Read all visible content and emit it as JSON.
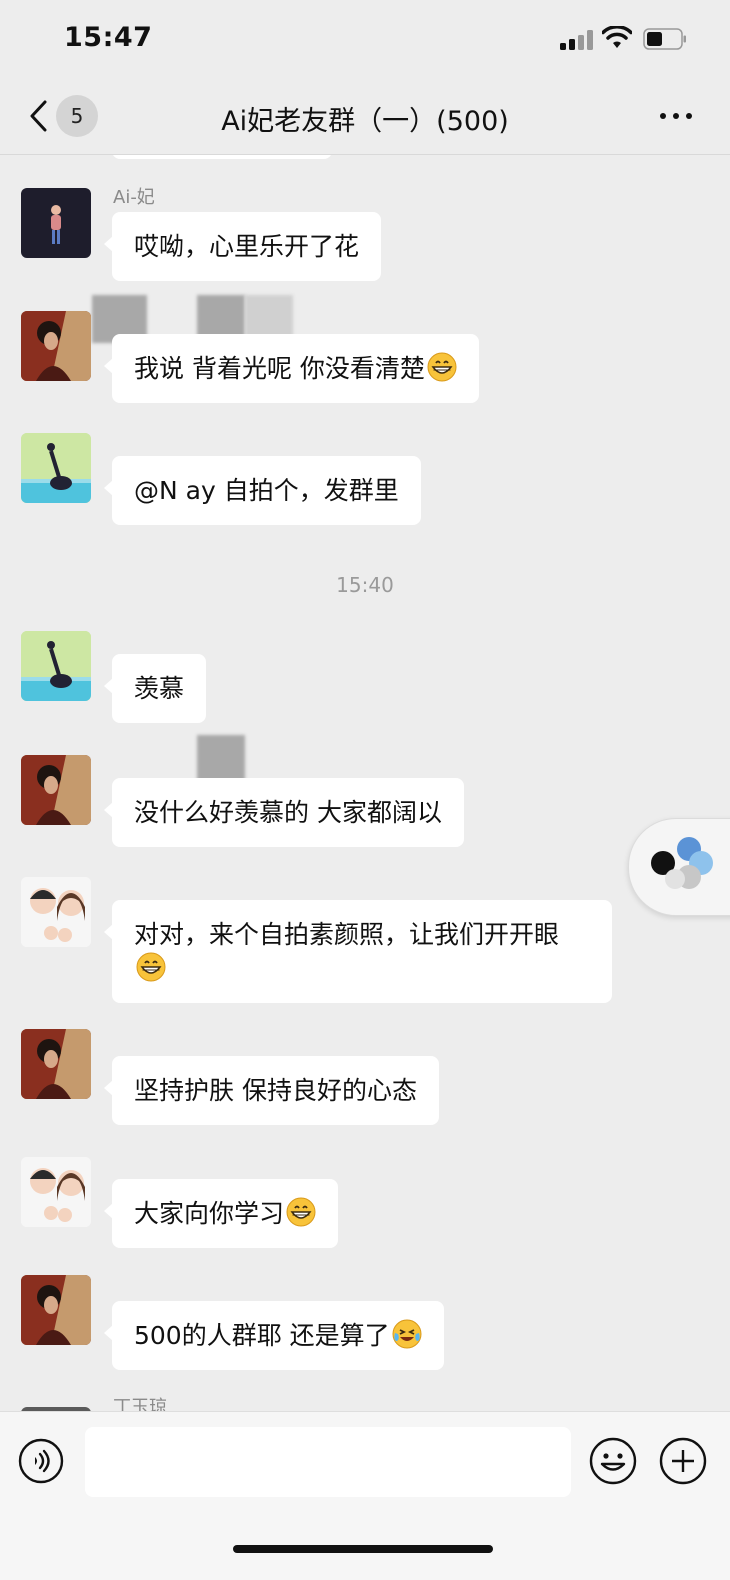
{
  "status_bar": {
    "time": "15:47"
  },
  "nav": {
    "unread_count": "5",
    "title": "Ai妃老友群（一）(500)"
  },
  "chat": {
    "timestamp": "15:40",
    "messages": [
      {
        "sender": "Ai-妃",
        "text": "哎呦，心里乐开了花",
        "avatar": "ai-fei"
      },
      {
        "sender": "",
        "text": "我说 背着光呢 你没看清楚",
        "emoji": "grin",
        "avatar": "woman-red"
      },
      {
        "sender": "",
        "text": "@N      ay 自拍个，发群里",
        "avatar": "yoga"
      },
      {
        "sender": "",
        "text": "羡慕",
        "avatar": "yoga"
      },
      {
        "sender": "",
        "text": "没什么好羡慕的 大家都阔以",
        "avatar": "woman-red"
      },
      {
        "sender": "",
        "text": "对对，来个自拍素颜照，让我们开开眼",
        "emoji": "grin",
        "avatar": "cartoon-family"
      },
      {
        "sender": "",
        "text": "坚持护肤 保持良好的心态",
        "avatar": "woman-red"
      },
      {
        "sender": "",
        "text": "大家向你学习",
        "emoji": "grin",
        "avatar": "cartoon-family"
      },
      {
        "sender": "",
        "text": "500的人群耶 还是算了",
        "emoji": "laugh-tears",
        "avatar": "woman-red"
      },
      {
        "sender": "丁玉琼",
        "text": "",
        "avatar": "partial"
      }
    ]
  },
  "input": {
    "placeholder": "",
    "value": ""
  },
  "icons": {
    "back": "chevron-left-icon",
    "more": "more-dots-icon",
    "voice": "voice-icon",
    "emoji": "smiley-icon",
    "plus": "plus-icon",
    "signal": "signal-icon",
    "wifi": "wifi-icon",
    "battery": "battery-icon"
  },
  "colors": {
    "background": "#ededed",
    "bubble": "#ffffff",
    "input_bar": "#f6f6f6"
  }
}
